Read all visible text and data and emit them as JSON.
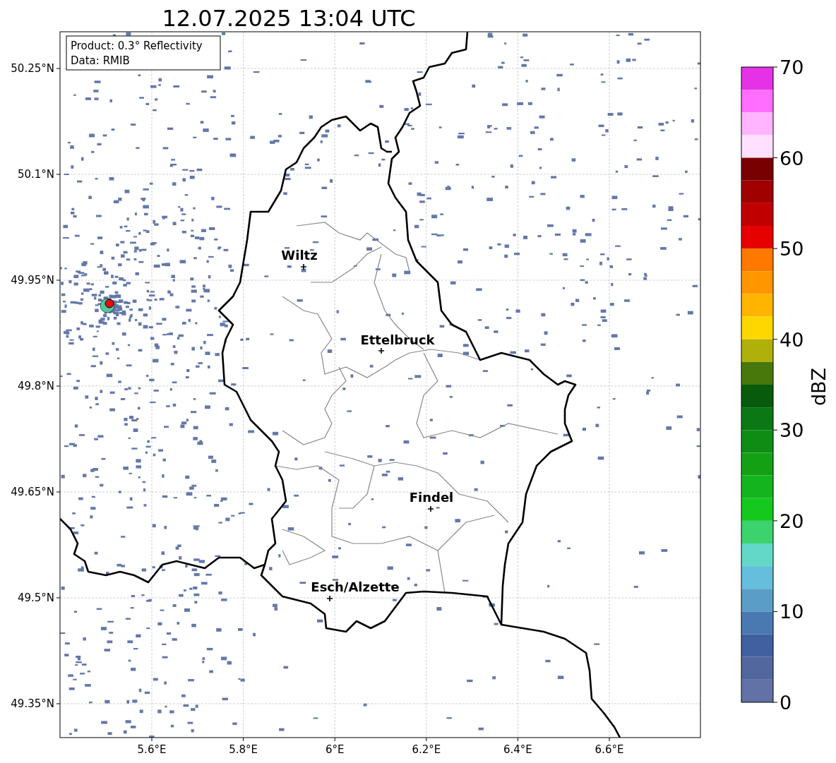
{
  "title": "12.07.2025 13:04 UTC",
  "info_box": [
    "Product: 0.3° Reflectivity",
    "Data: RMIB"
  ],
  "cities": [
    {
      "name": "Wiltz"
    },
    {
      "name": "Ettelbruck"
    },
    {
      "name": "Findel"
    },
    {
      "name": "Esch/Alzette"
    }
  ],
  "y_axis": [
    "50.25°N",
    "50.1°N",
    "49.95°N",
    "49.8°N",
    "49.65°N",
    "49.5°N",
    "49.35°N"
  ],
  "x_axis": [
    "5.6°E",
    "5.8°E",
    "6°E",
    "6.2°E",
    "6.4°E",
    "6.6°E"
  ],
  "colorbar": {
    "label": "dBZ",
    "ticks": [
      "70",
      "60",
      "50",
      "40",
      "30",
      "20",
      "10",
      "0"
    ],
    "bands": [
      {
        "color": "#e632e6"
      },
      {
        "color": "#ff6eff"
      },
      {
        "color": "#ffb4ff"
      },
      {
        "color": "#ffe0ff"
      },
      {
        "color": "#780000"
      },
      {
        "color": "#a00000"
      },
      {
        "color": "#c00000"
      },
      {
        "color": "#e60000"
      },
      {
        "color": "#ff7800"
      },
      {
        "color": "#ff9600"
      },
      {
        "color": "#ffb400"
      },
      {
        "color": "#ffd700"
      },
      {
        "color": "#b0b00a"
      },
      {
        "color": "#48780c"
      },
      {
        "color": "#085a0c"
      },
      {
        "color": "#0a7814"
      },
      {
        "color": "#0f8c14"
      },
      {
        "color": "#14a014"
      },
      {
        "color": "#14b41e"
      },
      {
        "color": "#14c81e"
      },
      {
        "color": "#3cd26e"
      },
      {
        "color": "#64d8c8"
      },
      {
        "color": "#64bedc"
      },
      {
        "color": "#5a9ec8"
      },
      {
        "color": "#4a78b0"
      },
      {
        "color": "#4060a0"
      },
      {
        "color": "#53679f"
      },
      {
        "color": "#6272a6"
      }
    ]
  }
}
